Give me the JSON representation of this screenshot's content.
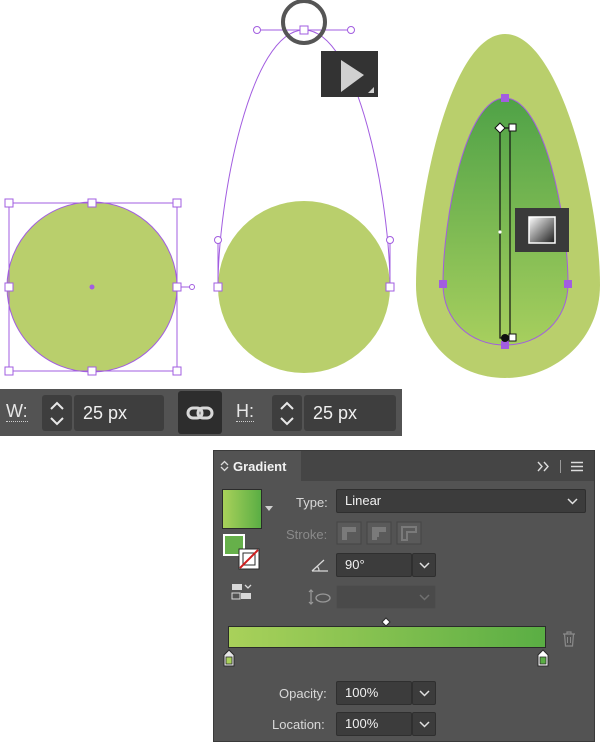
{
  "wh_bar": {
    "width_label": "W:",
    "width_value": "25 px",
    "height_label": "H:",
    "height_value": "25 px"
  },
  "gradient_panel": {
    "title": "Gradient",
    "type_label": "Type:",
    "type_value": "Linear",
    "stroke_label": "Stroke:",
    "angle_value": "90°",
    "aspect_value": "",
    "opacity_label": "Opacity:",
    "opacity_value": "100%",
    "location_label": "Location:",
    "location_value": "100%",
    "gradient_start_color": "#a9d15a",
    "gradient_end_color": "#5aae44"
  },
  "colors": {
    "shape_fill": "#b9cf6c",
    "selection": "#a25de0",
    "panel_bg": "#535353"
  },
  "icons": [
    "direct-selection-arrow-icon",
    "gradient-tool-icon",
    "chevron-icon",
    "link-icon",
    "menu-icon"
  ]
}
